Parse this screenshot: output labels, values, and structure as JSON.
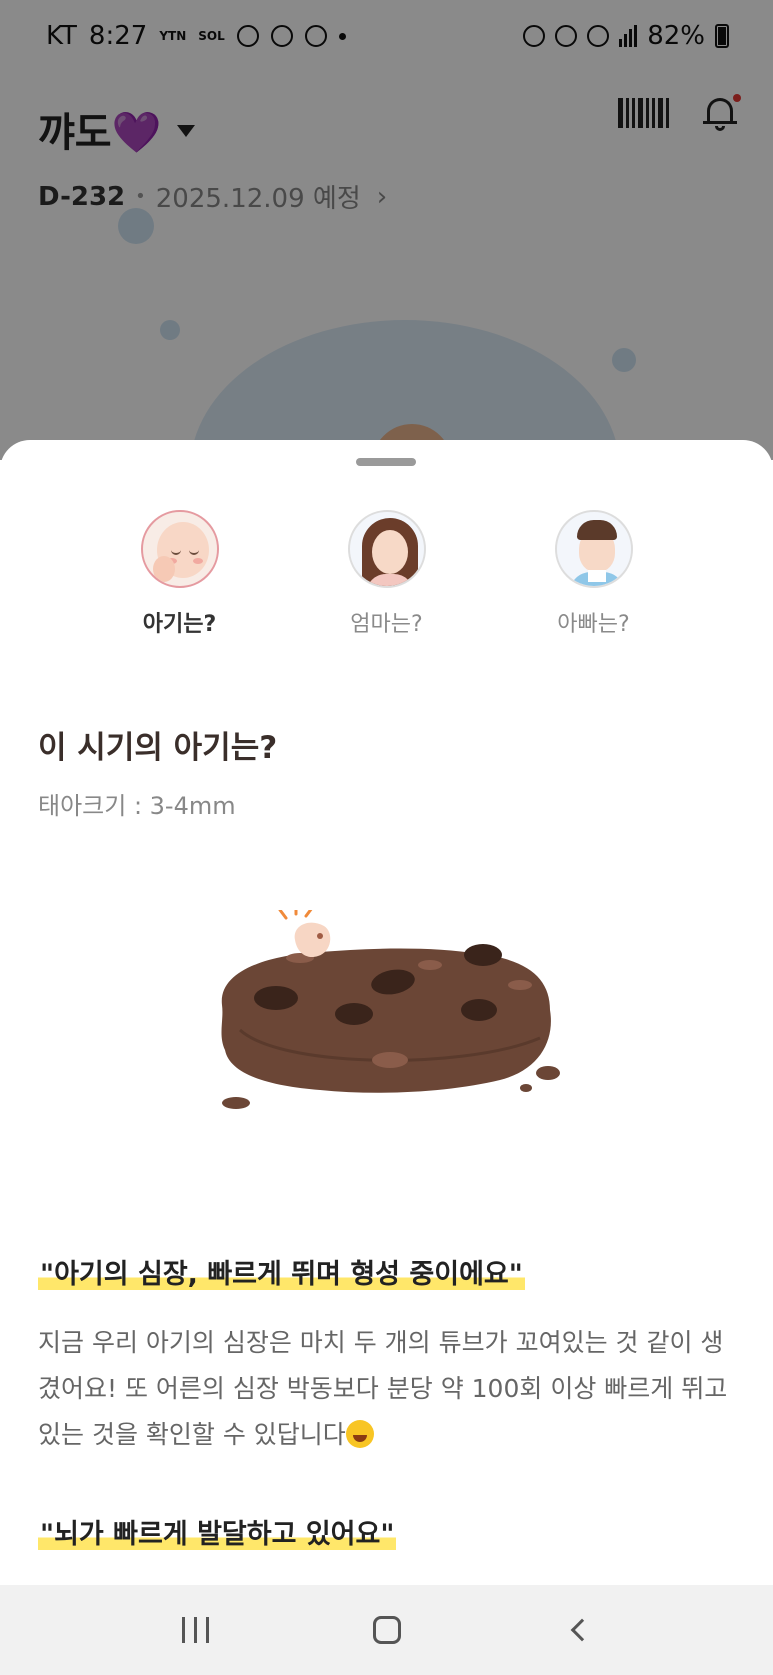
{
  "status_bar": {
    "carrier": "KT",
    "time": "8:27",
    "ytn": "YTN",
    "sol": "SOL",
    "battery_percent": "82%"
  },
  "header": {
    "baby_name": "꺄도💜",
    "dday": "D-232",
    "due_date": "2025.12.09 예정"
  },
  "tabs": [
    {
      "label": "아기는?",
      "active": true
    },
    {
      "label": "엄마는?",
      "active": false
    },
    {
      "label": "아빠는?",
      "active": false
    }
  ],
  "content": {
    "section_title": "이 시기의 아기는?",
    "fetal_size": "태아크기 : 3-4mm",
    "headline_1": "\"아기의 심장, 빠르게 뛰며 형성 중이에요\"",
    "paragraph_1": "지금 우리 아기의 심장은 마치 두 개의 튜브가 꼬여있는 것 같이 생겼어요! 또 어른의 심장 박동보다 분당 약 100회 이상 빠르게 뛰고 있는 것을 확인할 수 있답니다",
    "headline_2": "\"뇌가 빠르게 발달하고 있어요\""
  },
  "colors": {
    "highlight": "#ffe76a",
    "active_ring": "#e59aa0",
    "cookie": "#6b4636",
    "chip": "#3a241b"
  },
  "icons": {
    "barcode": "barcode-icon",
    "notifications": "bell-icon",
    "dropdown": "caret-down-icon",
    "date_link": "chevron-right-icon",
    "nav_recents": "recents-icon",
    "nav_home": "home-icon",
    "nav_back": "back-icon"
  }
}
